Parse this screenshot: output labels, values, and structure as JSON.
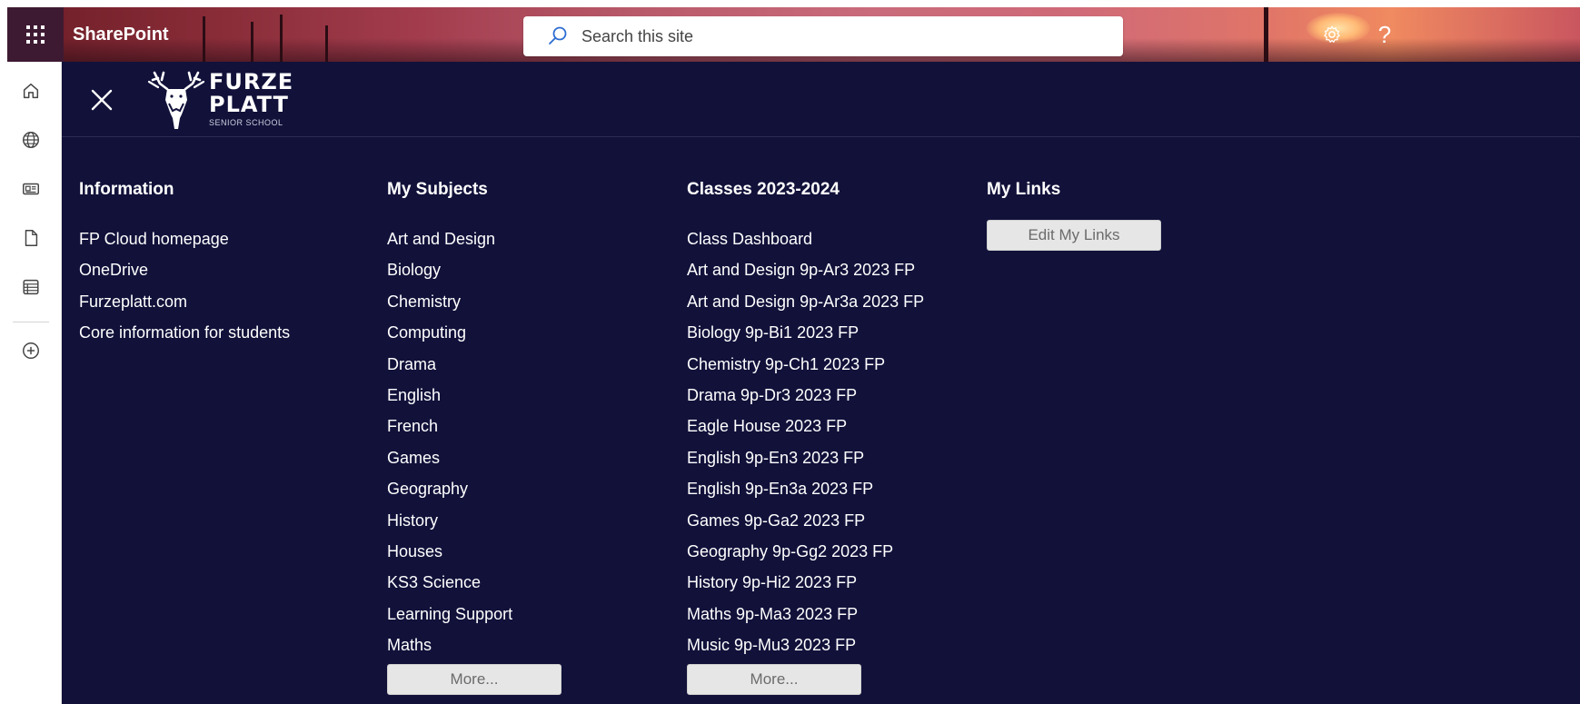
{
  "suite_bar": {
    "app_name": "SharePoint",
    "search_placeholder": "Search this site",
    "icons": [
      "waffle-icon",
      "search-icon",
      "gear-icon",
      "help-icon"
    ]
  },
  "left_rail": {
    "items": [
      "home-icon",
      "globe-icon",
      "news-icon",
      "file-icon",
      "list-icon",
      "add-circle-icon"
    ]
  },
  "mega_menu": {
    "logo": {
      "line1": "FURZE",
      "line2": "PLATT",
      "line3": "SENIOR SCHOOL"
    },
    "columns": {
      "information": {
        "title": "Information",
        "links": [
          "FP Cloud homepage",
          "OneDrive",
          "Furzeplatt.com",
          "Core information for students"
        ]
      },
      "subjects": {
        "title": "My Subjects",
        "links": [
          "Art and Design",
          "Biology",
          "Chemistry",
          "Computing",
          "Drama",
          "English",
          "French",
          "Games",
          "Geography",
          "History",
          "Houses",
          "KS3 Science",
          "Learning Support",
          "Maths"
        ],
        "more_label": "More..."
      },
      "classes": {
        "title": "Classes 2023-2024",
        "links": [
          "Class Dashboard",
          "Art and Design 9p-Ar3 2023 FP",
          "Art and Design 9p-Ar3a 2023 FP",
          "Biology 9p-Bi1 2023 FP",
          "Chemistry 9p-Ch1 2023 FP",
          "Drama 9p-Dr3 2023 FP",
          "Eagle House 2023 FP",
          "English 9p-En3 2023 FP",
          "English 9p-En3a 2023 FP",
          "Games 9p-Ga2 2023 FP",
          "Geography 9p-Gg2 2023 FP",
          "History 9p-Hi2 2023 FP",
          "Maths 9p-Ma3 2023 FP",
          "Music 9p-Mu3 2023 FP"
        ],
        "more_label": "More..."
      },
      "my_links": {
        "title": "My Links",
        "edit_label": "Edit My Links"
      }
    }
  },
  "colors": {
    "menu_background": "#11113a",
    "waffle_background": "#3e1a32",
    "button_background": "#e6e6e6"
  }
}
